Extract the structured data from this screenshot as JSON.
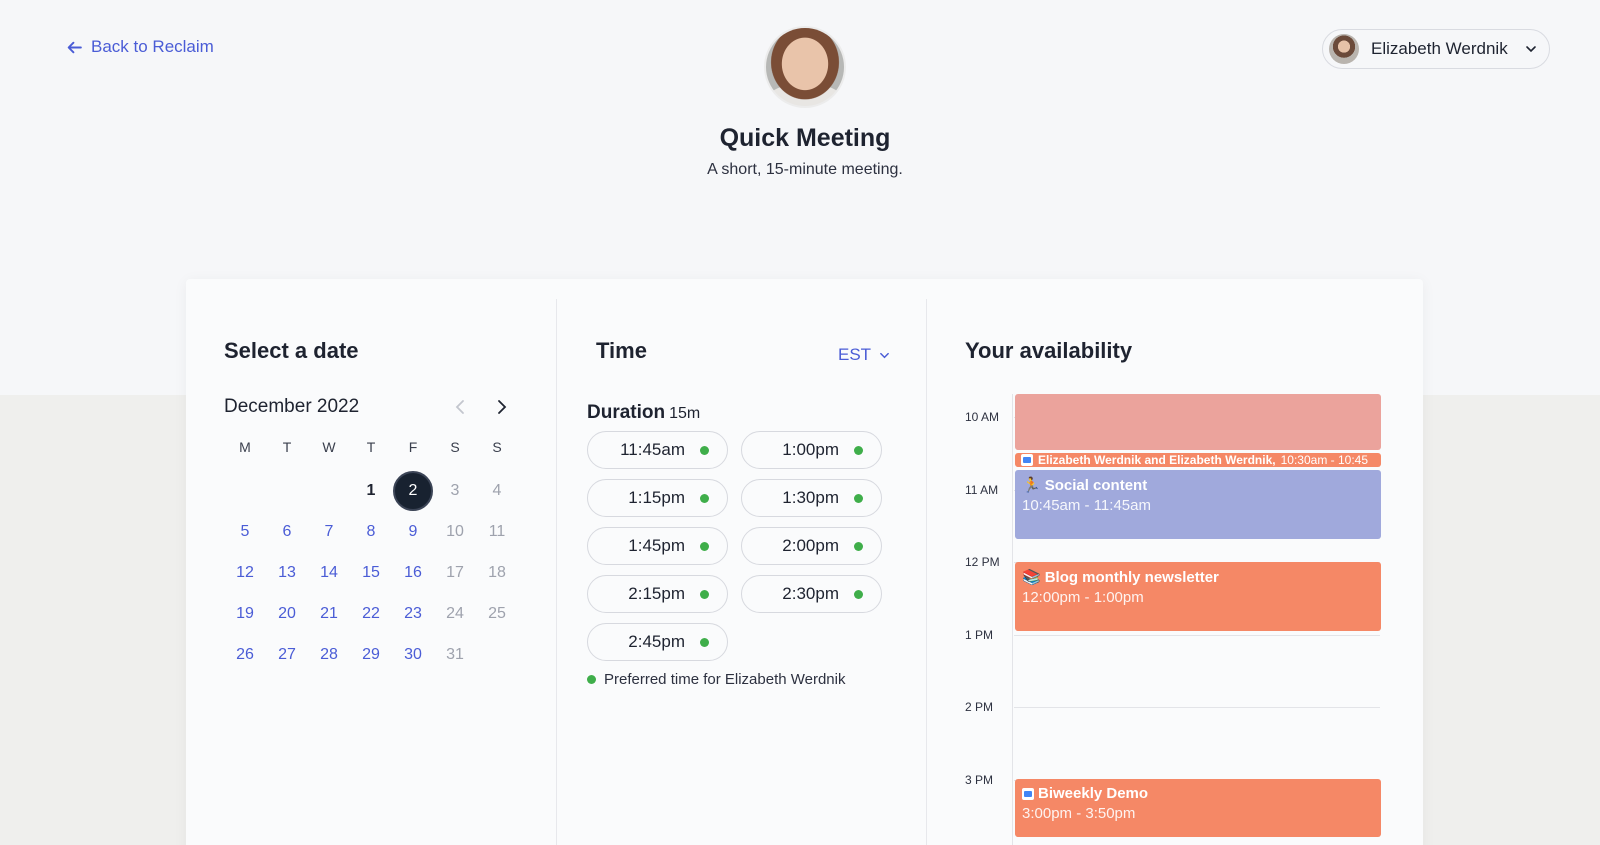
{
  "header": {
    "back_label": "Back to Reclaim",
    "user_name": "Elizabeth Werdnik",
    "meeting_title": "Quick Meeting",
    "meeting_subtitle": "A short, 15-minute meeting."
  },
  "date_picker": {
    "title": "Select a date",
    "month_label": "December 2022",
    "weekdays": [
      "M",
      "T",
      "W",
      "T",
      "F",
      "S",
      "S"
    ],
    "selected_day": "2"
  },
  "time": {
    "title": "Time",
    "timezone": "EST",
    "duration_label": "Duration",
    "duration_value": "15m",
    "slots": [
      "11:45am",
      "1:00pm",
      "1:15pm",
      "1:30pm",
      "1:45pm",
      "2:00pm",
      "2:15pm",
      "2:30pm",
      "2:45pm"
    ],
    "legend": "Preferred time for Elizabeth Werdnik"
  },
  "availability": {
    "title": "Your availability",
    "hours": [
      "10 AM",
      "11 AM",
      "12 PM",
      "1 PM",
      "2 PM",
      "3 PM"
    ],
    "events": {
      "shared_title": "Elizabeth Werdnik and Elizabeth Werdnik,",
      "shared_time": "10:30am - 10:45",
      "social_title": "Social content",
      "social_time": "10:45am - 11:45am",
      "blog_title": "Blog monthly newsletter",
      "blog_time": "12:00pm - 1:00pm",
      "demo_title": "Biweekly Demo",
      "demo_time": "3:00pm - 3:50pm"
    }
  },
  "colors": {
    "accent": "#4a5cd6",
    "preferred_dot": "#3fae4a",
    "event_orange": "#f58866",
    "event_pink": "#eba39c",
    "event_purple": "#a0a9dc"
  }
}
